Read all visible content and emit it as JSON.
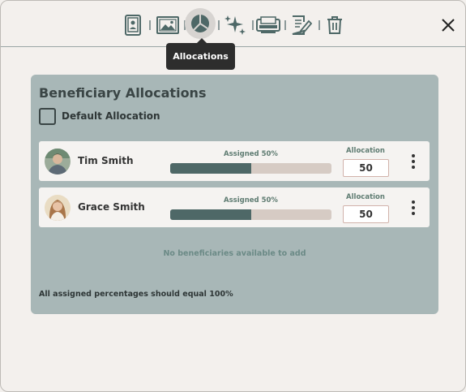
{
  "toolbar": {
    "icons": [
      "portrait-icon",
      "landscape-image-icon",
      "pie-chart-icon",
      "sparkles-icon",
      "scan-icon",
      "edit-document-icon",
      "trash-icon"
    ],
    "active": "pie-chart-icon",
    "tooltip": "Allocations"
  },
  "panel": {
    "title": "Beneficiary Allocations",
    "default_allocation_label": "Default Allocation",
    "default_allocation_checked": false,
    "beneficiaries": [
      {
        "name": "Tim Smith",
        "assigned_label": "Assigned 50%",
        "assigned_fraction": 0.5,
        "allocation_label": "Allocation",
        "allocation_value": "50"
      },
      {
        "name": "Grace Smith",
        "assigned_label": "Assigned 50%",
        "assigned_fraction": 0.5,
        "allocation_label": "Allocation",
        "allocation_value": "50"
      }
    ],
    "empty_message": "No beneficiaries available to add",
    "footer_note": "All assigned percentages should equal 100%"
  },
  "colors": {
    "panel_bg": "#a8b7b7",
    "bar_fill": "#4e6867",
    "bar_track": "#d6cbc4",
    "tooltip_bg": "#2d2d2d"
  }
}
